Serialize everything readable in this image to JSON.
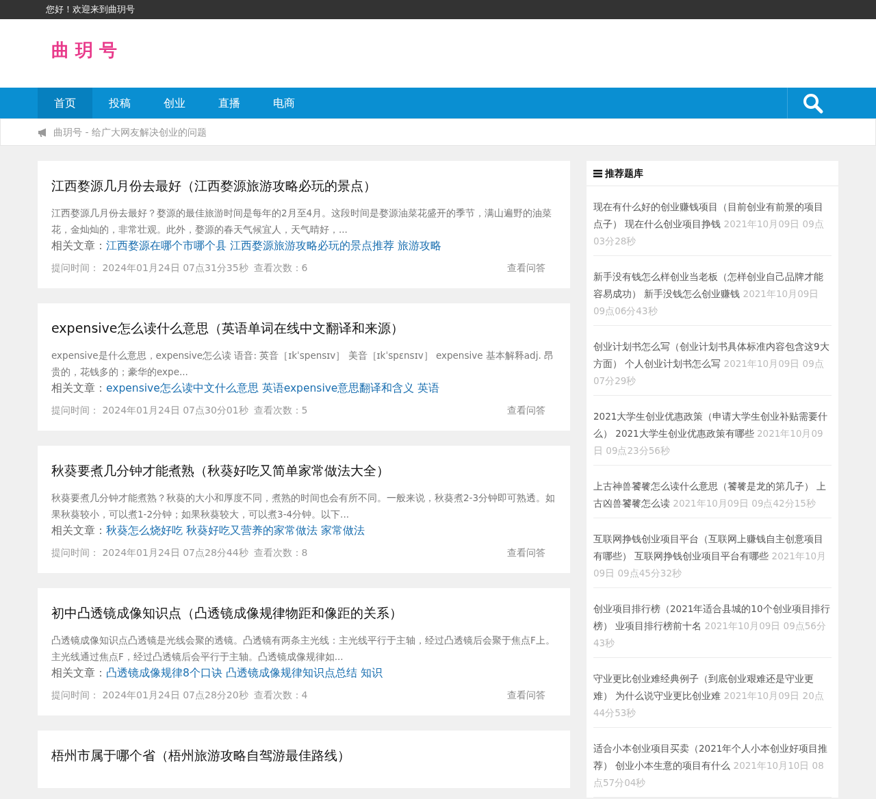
{
  "topbar": {
    "greeting": "您好！欢迎来到曲玥号"
  },
  "logo": {
    "text": "曲 玥 号"
  },
  "nav": {
    "items": [
      {
        "label": "首页",
        "selected": true
      },
      {
        "label": "投稿",
        "selected": false
      },
      {
        "label": "创业",
        "selected": false
      },
      {
        "label": "直播",
        "selected": false
      },
      {
        "label": "电商",
        "selected": false
      }
    ]
  },
  "notice": {
    "text": "曲玥号 - 给广大网友解决创业的问题"
  },
  "articles": [
    {
      "title": "江西婺源几月份去最好（江西婺源旅游攻略必玩的景点）",
      "excerpt": "江西婺源几月份去最好？婺源的最佳旅游时间是每年的2月至4月。这段时间是婺源油菜花盛开的季节，满山遍野的油菜花，金灿灿的，非常壮观。此外，婺源的春天气候宜人，天气晴好，...",
      "related_label": "相关文章：",
      "related": [
        "江西婺源在哪个市哪个县",
        "江西婺源旅游攻略必玩的景点推荐",
        "旅游攻略"
      ],
      "time_label": "提问时间：",
      "time": "2024年01月24日 07点31分35秒",
      "views_label": "查看次数：",
      "views": "6",
      "action": "查看问答"
    },
    {
      "title": "expensive怎么读什么意思（英语单词在线中文翻译和来源）",
      "excerpt": "expensive是什么意思，expensive怎么读 语音: 英音［ɪkˈspensɪv］ 美音［ɪkˈspɛnsɪv］ expensive 基本解释adj. 昂贵的，花钱多的；豪华的expe...",
      "related_label": "相关文章：",
      "related": [
        "expensive怎么读中文什么意思",
        "英语expensive意思翻译和含义",
        "英语"
      ],
      "time_label": "提问时间：",
      "time": "2024年01月24日 07点30分01秒",
      "views_label": "查看次数：",
      "views": "5",
      "action": "查看问答"
    },
    {
      "title": "秋葵要煮几分钟才能煮熟（秋葵好吃又简单家常做法大全）",
      "excerpt": "秋葵要煮几分钟才能煮熟？秋葵的大小和厚度不同，煮熟的时间也会有所不同。一般来说，秋葵煮2-3分钟即可熟透。如果秋葵较小，可以煮1-2分钟；如果秋葵较大，可以煮3-4分钟。以下...",
      "related_label": "相关文章：",
      "related": [
        "秋葵怎么烧好吃",
        "秋葵好吃又营养的家常做法",
        "家常做法"
      ],
      "time_label": "提问时间：",
      "time": "2024年01月24日 07点28分44秒",
      "views_label": "查看次数：",
      "views": "8",
      "action": "查看问答"
    },
    {
      "title": "初中凸透镜成像知识点（凸透镜成像规律物距和像距的关系）",
      "excerpt": "凸透镜成像知识点凸透镜是光线会聚的透镜。凸透镜有两条主光线：主光线平行于主轴，经过凸透镜后会聚于焦点F上。主光线通过焦点F，经过凸透镜后会平行于主轴。凸透镜成像规律如...",
      "related_label": "相关文章：",
      "related": [
        "凸透镜成像规律8个口诀",
        "凸透镜成像规律知识点总结",
        "知识"
      ],
      "time_label": "提问时间：",
      "time": "2024年01月24日 07点28分20秒",
      "views_label": "查看次数：",
      "views": "4",
      "action": "查看问答"
    },
    {
      "title": "梧州市属于哪个省（梧州旅游攻略自驾游最佳路线）"
    }
  ],
  "sidebar": {
    "title": "推荐题库",
    "items": [
      {
        "title": "现在有什么好的创业赚钱项目（目前创业有前景的项目点子） 现在什么创业项目挣钱",
        "date": "2021年10月09日 09点03分28秒"
      },
      {
        "title": "新手没有钱怎么样创业当老板（怎样创业自己品牌才能容易成功） 新手没钱怎么创业赚钱",
        "date": "2021年10月09日 09点06分43秒"
      },
      {
        "title": "创业计划书怎么写（创业计划书具体标准内容包含这9大方面） 个人创业计划书怎么写",
        "date": "2021年10月09日 09点07分29秒"
      },
      {
        "title": "2021大学生创业优惠政策（申请大学生创业补贴需要什么） 2021大学生创业优惠政策有哪些",
        "date": "2021年10月09日 09点23分56秒"
      },
      {
        "title": "上古神兽饕餮怎么读什么意思（饕餮是龙的第几子） 上古凶兽饕餮怎么读",
        "date": "2021年10月09日 09点42分15秒"
      },
      {
        "title": "互联网挣钱创业项目平台（互联网上赚钱自主创意项目有哪些） 互联网挣钱创业项目平台有哪些",
        "date": "2021年10月09日 09点45分32秒"
      },
      {
        "title": "创业项目排行榜（2021年适合县城的10个创业项目排行榜） 业项目排行榜前十名",
        "date": "2021年10月09日 09点56分43秒"
      },
      {
        "title": "守业更比创业难经典例子（到底创业艰难还是守业更难） 为什么说守业更比创业难",
        "date": "2021年10月09日 20点44分53秒"
      },
      {
        "title": "适合小本创业项目买卖（2021年个人小本创业好项目推荐） 创业小本生意的项目有什么",
        "date": "2021年10月10日 08点57分04秒"
      }
    ]
  }
}
